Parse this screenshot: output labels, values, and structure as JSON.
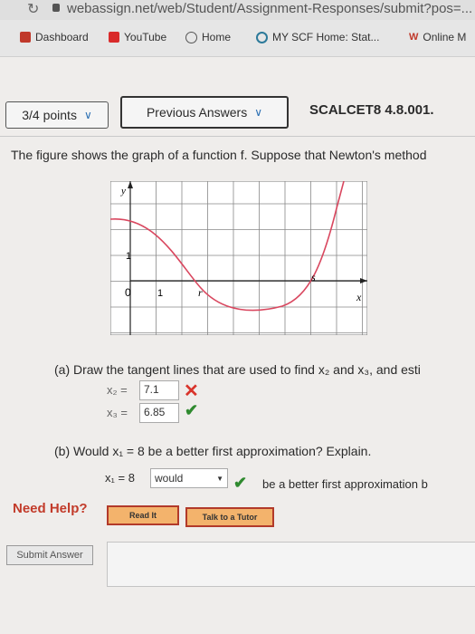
{
  "browser": {
    "url": "webassign.net/web/Student/Assignment-Responses/submit?pos=...",
    "bookmarks": [
      {
        "label": "Dashboard",
        "icon": "dashboard-icon",
        "color": "#c0392b"
      },
      {
        "label": "YouTube",
        "icon": "youtube-icon",
        "color": "#d92b2b"
      },
      {
        "label": "Home",
        "icon": "home-icon",
        "color": "#555555"
      },
      {
        "label": "MY SCF Home: Stat...",
        "icon": "scf-icon",
        "color": "#2d7a9a"
      },
      {
        "label": "Online M",
        "icon": "online-icon",
        "color": "#c0392b"
      }
    ]
  },
  "header": {
    "points_label": "3/4 points",
    "previous_answers_label": "Previous Answers",
    "problem_id": "SCALCET8 4.8.001."
  },
  "question": {
    "intro": "The figure shows the graph of a function f. Suppose that Newton's method"
  },
  "graph": {
    "y_label": "y",
    "x_label": "x",
    "tick_one_y": "1",
    "tick_zero": "0",
    "tick_one_x": "1",
    "r_label": "r",
    "s_label": "s"
  },
  "part_a": {
    "prompt": "(a) Draw the tangent lines that are used to find x₂ and x₃, and esti",
    "x2_label": "x₂  =",
    "x2_value": "7.1",
    "x2_status": "incorrect",
    "x3_label": "x₃  =",
    "x3_value": "6.85",
    "x3_status": "correct"
  },
  "part_b": {
    "prompt": "(b) Would  x₁ = 8  be a better first approximation? Explain.",
    "x1_label": "x₁ = 8",
    "selected": "would",
    "status": "correct",
    "suffix": "be a better first approximation b"
  },
  "help": {
    "label": "Need Help?",
    "read_it": "Read It",
    "talk_to_tutor": "Talk to a Tutor"
  },
  "submit_label": "Submit Answer",
  "colors": {
    "curve": "#d9475f",
    "incorrect": "#d9342b",
    "correct": "#2f8a2f",
    "help_button": "#f3b36c"
  }
}
